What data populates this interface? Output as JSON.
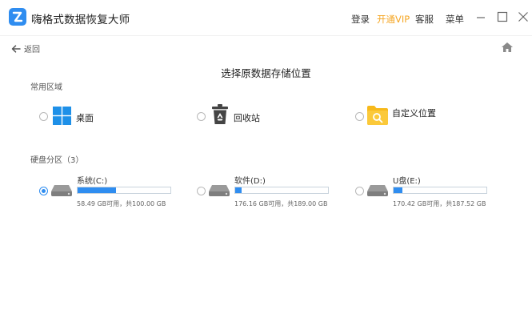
{
  "app": {
    "title": "嗨格式数据恢复大师",
    "nav": {
      "login": "登录",
      "vip": "开通VIP",
      "service": "客服",
      "menu": "菜单"
    },
    "colors": {
      "accent": "#2f8df0",
      "vip": "#f5a623"
    }
  },
  "toolbar": {
    "back_label": "返回"
  },
  "page": {
    "title": "选择原数据存储位置"
  },
  "common": {
    "label": "常用区域",
    "items": [
      {
        "label": "桌面",
        "icon": "windows-icon",
        "selected": false
      },
      {
        "label": "回收站",
        "icon": "recycle-bin-icon",
        "selected": false
      },
      {
        "label": "自定义位置",
        "icon": "custom-folder-icon",
        "selected": false
      }
    ]
  },
  "disks": {
    "label": "硬盘分区（3）",
    "items": [
      {
        "name": "系统(C:)",
        "size_text": "58.49 GB可用，共100.00 GB",
        "used_fraction": 0.4151,
        "selected": true
      },
      {
        "name": "软件(D:)",
        "size_text": "176.16 GB可用，共189.00 GB",
        "used_fraction": 0.0679,
        "selected": false
      },
      {
        "name": "U盘(E:)",
        "size_text": "170.42 GB可用，共187.52 GB",
        "used_fraction": 0.0912,
        "selected": false
      }
    ]
  }
}
